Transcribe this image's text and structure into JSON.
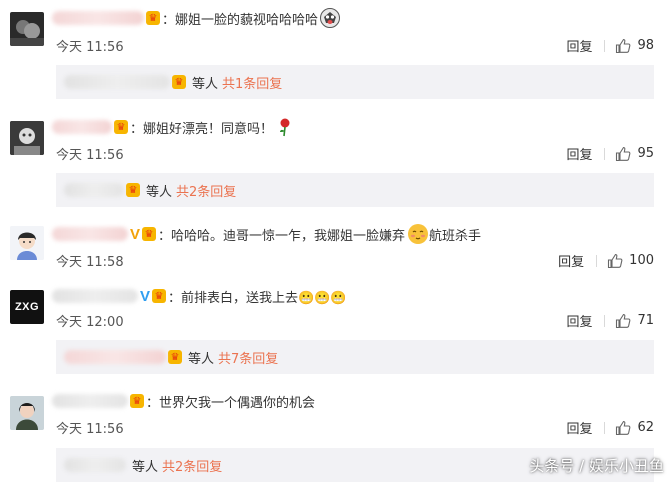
{
  "comments": [
    {
      "text": "：娜姐一脸的藐视哈哈哈哈",
      "time": "今天 11:56",
      "reply_label": "回复",
      "likes": "98",
      "replies": {
        "people_label": "等人",
        "count_label": "共1条回复"
      }
    },
    {
      "text": "：娜姐好漂亮！同意吗！",
      "time": "今天 11:56",
      "reply_label": "回复",
      "likes": "95",
      "replies": {
        "people_label": "等人",
        "count_label": "共2条回复"
      }
    },
    {
      "text": "：哈哈哈。迪哥一惊一乍，我娜姐一脸嫌弃",
      "text2": "航班杀手",
      "time": "今天 11:58",
      "reply_label": "回复",
      "likes": "100"
    },
    {
      "text": "：前排表白，送我上去😬😬😬",
      "avatar_text": "ZXG",
      "time": "今天 12:00",
      "reply_label": "回复",
      "likes": "71",
      "replies": {
        "people_label": "等人",
        "count_label": "共7条回复"
      }
    },
    {
      "text": "：世界欠我一个偶遇你的机会",
      "time": "今天 11:56",
      "reply_label": "回复",
      "likes": "62",
      "replies": {
        "people_label": "等人",
        "count_label": "共2条回复"
      }
    }
  ],
  "watermark": "头条号 / 娱乐小丑鱼",
  "colors": {
    "link": "#eb7350",
    "reply_bg": "#f2f2f5",
    "badge": "#f7b500"
  },
  "icons": {
    "like": "thumbs-up-icon",
    "badge": "member-crown-icon",
    "verified": "verified-v-icon"
  }
}
